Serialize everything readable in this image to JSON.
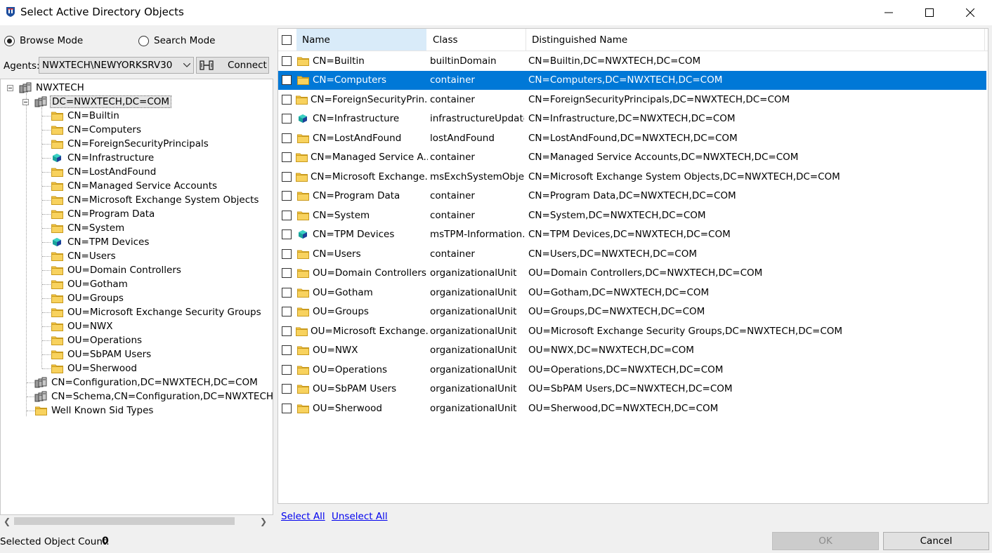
{
  "window": {
    "title": "Select Active Directory Objects",
    "controls": {
      "minimize": "minimize-icon",
      "maximize": "maximize-icon",
      "close": "close-icon"
    }
  },
  "mode": {
    "browse_label": "Browse Mode",
    "search_label": "Search Mode",
    "selected": "Browse Mode"
  },
  "agents": {
    "label": "Agents:",
    "value": "NWXTECH\\NEWYORKSRV30",
    "connect_label": "Connect"
  },
  "tree": {
    "root": "NWXTECH",
    "domain": "DC=NWXTECH,DC=COM",
    "domain_children": [
      {
        "label": "CN=Builtin",
        "icon": "folder"
      },
      {
        "label": "CN=Computers",
        "icon": "folder"
      },
      {
        "label": "CN=ForeignSecurityPrincipals",
        "icon": "folder"
      },
      {
        "label": "CN=Infrastructure",
        "icon": "cube"
      },
      {
        "label": "CN=LostAndFound",
        "icon": "folder"
      },
      {
        "label": "CN=Managed Service Accounts",
        "icon": "folder"
      },
      {
        "label": "CN=Microsoft Exchange System Objects",
        "icon": "folder"
      },
      {
        "label": "CN=Program Data",
        "icon": "folder"
      },
      {
        "label": "CN=System",
        "icon": "folder"
      },
      {
        "label": "CN=TPM Devices",
        "icon": "cube"
      },
      {
        "label": "CN=Users",
        "icon": "folder"
      },
      {
        "label": "OU=Domain Controllers",
        "icon": "folder"
      },
      {
        "label": "OU=Gotham",
        "icon": "folder"
      },
      {
        "label": "OU=Groups",
        "icon": "folder"
      },
      {
        "label": "OU=Microsoft Exchange Security Groups",
        "icon": "folder"
      },
      {
        "label": "OU=NWX",
        "icon": "folder"
      },
      {
        "label": "OU=Operations",
        "icon": "folder"
      },
      {
        "label": "OU=SbPAM Users",
        "icon": "folder"
      },
      {
        "label": "OU=Sherwood",
        "icon": "folder"
      }
    ],
    "others": [
      {
        "label": "CN=Configuration,DC=NWXTECH,DC=COM",
        "icon": "server"
      },
      {
        "label": "CN=Schema,CN=Configuration,DC=NWXTECH,DC=COM",
        "icon": "server"
      },
      {
        "label": "Well Known Sid Types",
        "icon": "folder"
      }
    ]
  },
  "list": {
    "columns": {
      "name": "Name",
      "class": "Class",
      "dn": "Distinguished Name"
    },
    "rows": [
      {
        "name": "CN=Builtin",
        "class": "builtinDomain",
        "dn": "CN=Builtin,DC=NWXTECH,DC=COM",
        "icon": "folder"
      },
      {
        "name": "CN=Computers",
        "class": "container",
        "dn": "CN=Computers,DC=NWXTECH,DC=COM",
        "icon": "folder",
        "selected": true
      },
      {
        "name": "CN=ForeignSecurityPrin...",
        "class": "container",
        "dn": "CN=ForeignSecurityPrincipals,DC=NWXTECH,DC=COM",
        "icon": "folder"
      },
      {
        "name": "CN=Infrastructure",
        "class": "infrastructureUpdate",
        "dn": "CN=Infrastructure,DC=NWXTECH,DC=COM",
        "icon": "cube"
      },
      {
        "name": "CN=LostAndFound",
        "class": "lostAndFound",
        "dn": "CN=LostAndFound,DC=NWXTECH,DC=COM",
        "icon": "folder"
      },
      {
        "name": "CN=Managed Service A...",
        "class": "container",
        "dn": "CN=Managed Service Accounts,DC=NWXTECH,DC=COM",
        "icon": "folder"
      },
      {
        "name": "CN=Microsoft Exchange...",
        "class": "msExchSystemObje...",
        "dn": "CN=Microsoft Exchange System Objects,DC=NWXTECH,DC=COM",
        "icon": "folder"
      },
      {
        "name": "CN=Program Data",
        "class": "container",
        "dn": "CN=Program Data,DC=NWXTECH,DC=COM",
        "icon": "folder"
      },
      {
        "name": "CN=System",
        "class": "container",
        "dn": "CN=System,DC=NWXTECH,DC=COM",
        "icon": "folder"
      },
      {
        "name": "CN=TPM Devices",
        "class": "msTPM-Information...",
        "dn": "CN=TPM Devices,DC=NWXTECH,DC=COM",
        "icon": "cube"
      },
      {
        "name": "CN=Users",
        "class": "container",
        "dn": "CN=Users,DC=NWXTECH,DC=COM",
        "icon": "folder"
      },
      {
        "name": "OU=Domain Controllers",
        "class": "organizationalUnit",
        "dn": "OU=Domain Controllers,DC=NWXTECH,DC=COM",
        "icon": "folder"
      },
      {
        "name": "OU=Gotham",
        "class": "organizationalUnit",
        "dn": "OU=Gotham,DC=NWXTECH,DC=COM",
        "icon": "folder"
      },
      {
        "name": "OU=Groups",
        "class": "organizationalUnit",
        "dn": "OU=Groups,DC=NWXTECH,DC=COM",
        "icon": "folder"
      },
      {
        "name": "OU=Microsoft Exchange...",
        "class": "organizationalUnit",
        "dn": "OU=Microsoft Exchange Security Groups,DC=NWXTECH,DC=COM",
        "icon": "folder"
      },
      {
        "name": "OU=NWX",
        "class": "organizationalUnit",
        "dn": "OU=NWX,DC=NWXTECH,DC=COM",
        "icon": "folder"
      },
      {
        "name": "OU=Operations",
        "class": "organizationalUnit",
        "dn": "OU=Operations,DC=NWXTECH,DC=COM",
        "icon": "folder"
      },
      {
        "name": "OU=SbPAM Users",
        "class": "organizationalUnit",
        "dn": "OU=SbPAM Users,DC=NWXTECH,DC=COM",
        "icon": "folder"
      },
      {
        "name": "OU=Sherwood",
        "class": "organizationalUnit",
        "dn": "OU=Sherwood,DC=NWXTECH,DC=COM",
        "icon": "folder"
      }
    ]
  },
  "links": {
    "select_all": "Select All",
    "unselect_all": "Unselect All"
  },
  "footer": {
    "count_label": "Selected Object Count:",
    "count_value": "0",
    "ok_label": "OK",
    "cancel_label": "Cancel"
  },
  "colors": {
    "selection": "#0078d7",
    "folder": "#f4c542",
    "link": "#0000ee"
  }
}
